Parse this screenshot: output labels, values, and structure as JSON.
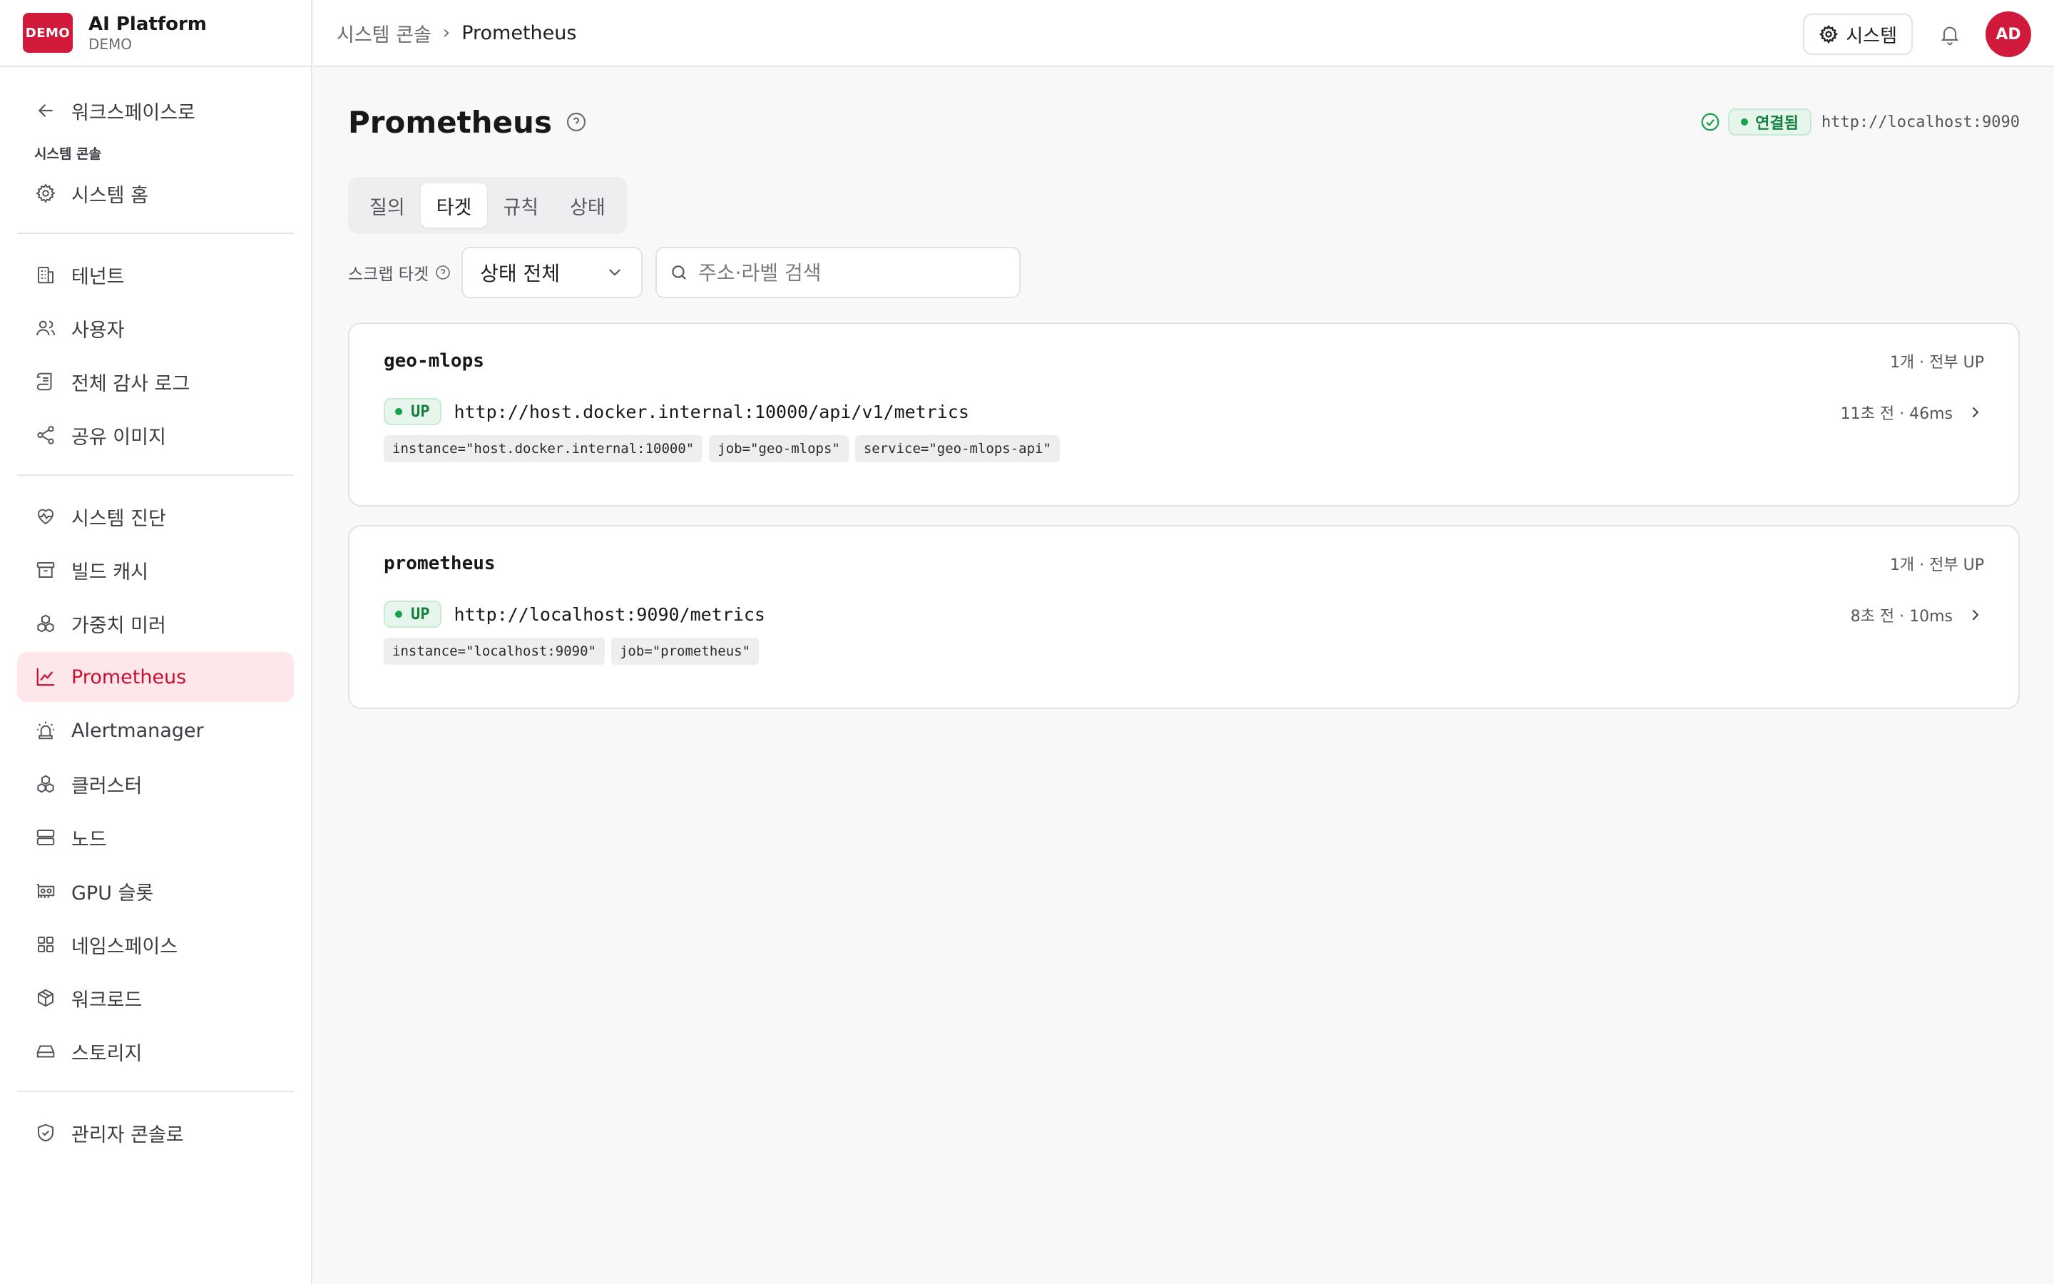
{
  "brand": {
    "logo_text": "DEMO",
    "name": "AI Platform",
    "sub": "DEMO"
  },
  "sidebar": {
    "back": "워크스페이스로",
    "section_title": "시스템 콘솔",
    "home": "시스템 홈",
    "group1": [
      "테넌트",
      "사용자",
      "전체 감사 로그",
      "공유 이미지"
    ],
    "group2": [
      "시스템 진단",
      "빌드 캐시",
      "가중치 미러",
      "Prometheus",
      "Alertmanager",
      "클러스터",
      "노드",
      "GPU 슬롯",
      "네임스페이스",
      "워크로드",
      "스토리지"
    ],
    "admin": "관리자 콘솔로",
    "active": "Prometheus"
  },
  "topbar": {
    "crumb_parent": "시스템 콘솔",
    "crumb_sep": "›",
    "crumb_current": "Prometheus",
    "system_button": "시스템",
    "avatar": "AD"
  },
  "page": {
    "title": "Prometheus",
    "connection_status": "연결됨",
    "connection_url": "http://localhost:9090",
    "tabs": [
      "질의",
      "타겟",
      "규칙",
      "상태"
    ],
    "active_tab": "타겟"
  },
  "filter": {
    "label": "스크랩 타겟",
    "select_value": "상태 전체",
    "search_placeholder": "주소·라벨 검색"
  },
  "jobs": [
    {
      "name": "geo-mlops",
      "summary": "1개 · 전부 UP",
      "target": {
        "status": "UP",
        "url": "http://host.docker.internal:10000/api/v1/metrics",
        "meta": "11초 전 · 46ms",
        "labels": [
          "instance=\"host.docker.internal:10000\"",
          "job=\"geo-mlops\"",
          "service=\"geo-mlops-api\""
        ]
      }
    },
    {
      "name": "prometheus",
      "summary": "1개 · 전부 UP",
      "target": {
        "status": "UP",
        "url": "http://localhost:9090/metrics",
        "meta": "8초 전 · 10ms",
        "labels": [
          "instance=\"localhost:9090\"",
          "job=\"prometheus\""
        ]
      }
    }
  ],
  "colors": {
    "brand": "#d11a3b",
    "active_bg": "#fde7ea",
    "active_text": "#c8102e",
    "ok": "#16a34a",
    "ok_bg": "#e6f6ec"
  }
}
